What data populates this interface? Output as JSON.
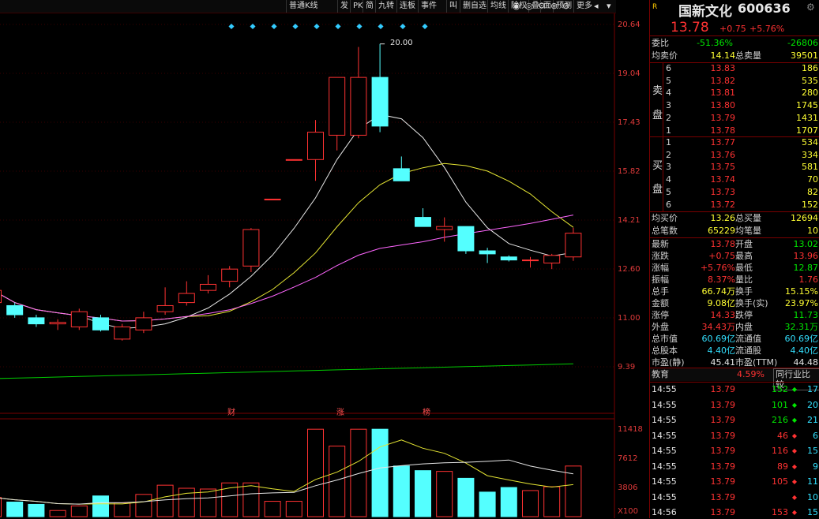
{
  "toolbar": {
    "items": [
      "普通K线",
      "发",
      "PK",
      "简",
      "九转",
      "连板",
      "事件",
      "叫",
      "删自选",
      "均线",
      "除权",
      "叠",
      "面",
      "预测",
      "更多"
    ],
    "icons": [
      "eye-icon",
      "eye-off-icon",
      "settings-icon",
      "zoom-in-icon",
      "zoom-out-icon",
      "back-icon",
      "next-icon"
    ]
  },
  "chart": {
    "y_ticks": [
      "20.64",
      "19.04",
      "17.43",
      "15.82",
      "14.21",
      "12.60",
      "11.00",
      "9.39"
    ],
    "high_label": "20.00",
    "event_markers": [
      "财",
      "涨",
      "榜"
    ],
    "volume_ticks": [
      "11418",
      "7612",
      "3806",
      "X100"
    ]
  },
  "chart_data": [
    {
      "type": "candlestick",
      "title": "",
      "ylim": [
        9.39,
        20.64
      ],
      "candles": [
        {
          "o": 11.5,
          "c": 11.9,
          "h": 12.0,
          "l": 11.4,
          "up": true
        },
        {
          "o": 11.4,
          "c": 11.1,
          "h": 11.5,
          "l": 11.0,
          "up": false
        },
        {
          "o": 11.0,
          "c": 10.8,
          "h": 11.1,
          "l": 10.7,
          "up": false
        },
        {
          "o": 10.8,
          "c": 10.85,
          "h": 10.95,
          "l": 10.6,
          "up": true
        },
        {
          "o": 11.2,
          "c": 10.7,
          "h": 11.3,
          "l": 10.6,
          "up": true
        },
        {
          "o": 11.0,
          "c": 10.6,
          "h": 11.1,
          "l": 10.55,
          "up": false
        },
        {
          "o": 10.7,
          "c": 10.3,
          "h": 10.8,
          "l": 10.25,
          "up": true
        },
        {
          "o": 10.6,
          "c": 11.0,
          "h": 11.2,
          "l": 10.5,
          "up": true
        },
        {
          "o": 11.2,
          "c": 11.4,
          "h": 12.0,
          "l": 11.1,
          "up": true
        },
        {
          "o": 11.5,
          "c": 11.8,
          "h": 12.2,
          "l": 11.4,
          "up": true
        },
        {
          "o": 11.9,
          "c": 12.1,
          "h": 12.4,
          "l": 11.8,
          "up": true
        },
        {
          "o": 12.2,
          "c": 12.6,
          "h": 12.7,
          "l": 12.0,
          "up": true
        },
        {
          "o": 12.7,
          "c": 13.9,
          "h": 13.95,
          "l": 12.5,
          "up": true
        },
        {
          "o": 14.9,
          "c": 14.9,
          "h": 14.9,
          "l": 14.9,
          "up": true
        },
        {
          "o": 16.2,
          "c": 16.2,
          "h": 16.2,
          "l": 16.2,
          "up": true
        },
        {
          "o": 16.2,
          "c": 17.1,
          "h": 17.5,
          "l": 15.5,
          "up": true
        },
        {
          "o": 17.0,
          "c": 18.9,
          "h": 18.9,
          "l": 16.5,
          "up": true
        },
        {
          "o": 17.0,
          "c": 18.9,
          "h": 19.9,
          "l": 16.9,
          "up": true
        },
        {
          "o": 18.9,
          "c": 17.3,
          "h": 20.0,
          "l": 17.1,
          "up": false
        },
        {
          "o": 15.9,
          "c": 15.5,
          "h": 16.3,
          "l": 15.5,
          "up": false
        },
        {
          "o": 14.3,
          "c": 14.0,
          "h": 14.6,
          "l": 14.0,
          "up": false
        },
        {
          "o": 13.9,
          "c": 14.0,
          "h": 14.3,
          "l": 13.5,
          "up": true
        },
        {
          "o": 14.0,
          "c": 13.2,
          "h": 14.0,
          "l": 13.1,
          "up": false
        },
        {
          "o": 13.2,
          "c": 13.1,
          "h": 13.3,
          "l": 12.8,
          "up": false
        },
        {
          "o": 13.0,
          "c": 12.9,
          "h": 13.05,
          "l": 12.85,
          "up": false
        },
        {
          "o": 12.9,
          "c": 12.9,
          "h": 13.0,
          "l": 12.65,
          "up": true
        },
        {
          "o": 12.8,
          "c": 13.05,
          "h": 13.1,
          "l": 12.6,
          "up": true
        },
        {
          "o": 13.0,
          "c": 13.78,
          "h": 13.96,
          "l": 12.87,
          "up": true
        }
      ],
      "volumes": [
        2500,
        1900,
        1600,
        800,
        1400,
        2700,
        1800,
        2900,
        4100,
        3700,
        3600,
        4400,
        4400,
        2000,
        2000,
        11400,
        9200,
        11400,
        11400,
        6600,
        6000,
        5900,
        5000,
        3200,
        3800,
        3400,
        3900,
        6600
      ]
    }
  ],
  "quote": {
    "name": "国新文化",
    "code": "600636",
    "price": "13.78",
    "change": "+0.75",
    "change_pct": "+5.76%",
    "weibi_label": "委比",
    "weibi": "-51.36%",
    "weicha": "-26806",
    "avg_sell_label": "均卖价",
    "avg_sell": "14.14",
    "total_sell_label": "总卖量",
    "total_sell": "39501",
    "sell_side_label": [
      "卖",
      "盘"
    ],
    "buy_side_label": [
      "买",
      "盘"
    ],
    "asks": [
      {
        "lvl": "6",
        "p": "13.83",
        "v": "186"
      },
      {
        "lvl": "5",
        "p": "13.82",
        "v": "535"
      },
      {
        "lvl": "4",
        "p": "13.81",
        "v": "280"
      },
      {
        "lvl": "3",
        "p": "13.80",
        "v": "1745"
      },
      {
        "lvl": "2",
        "p": "13.79",
        "v": "1431"
      },
      {
        "lvl": "1",
        "p": "13.78",
        "v": "1707"
      }
    ],
    "bids": [
      {
        "lvl": "1",
        "p": "13.77",
        "v": "534"
      },
      {
        "lvl": "2",
        "p": "13.76",
        "v": "334"
      },
      {
        "lvl": "3",
        "p": "13.75",
        "v": "581"
      },
      {
        "lvl": "4",
        "p": "13.74",
        "v": "70"
      },
      {
        "lvl": "5",
        "p": "13.73",
        "v": "82"
      },
      {
        "lvl": "6",
        "p": "13.72",
        "v": "152"
      }
    ],
    "avg_buy_label": "均买价",
    "avg_buy": "13.26",
    "total_buy_label": "总买量",
    "total_buy": "12694",
    "total_orders_label": "总笔数",
    "total_orders": "65229",
    "avg_order_label": "均笔量",
    "avg_order": "10",
    "stats": [
      {
        "l1": "最新",
        "v1": "13.78",
        "c1": "red",
        "l2": "开盘",
        "v2": "13.02",
        "c2": "green"
      },
      {
        "l1": "涨跌",
        "v1": "+0.75",
        "c1": "red",
        "l2": "最高",
        "v2": "13.96",
        "c2": "red"
      },
      {
        "l1": "涨幅",
        "v1": "+5.76%",
        "c1": "red",
        "l2": "最低",
        "v2": "12.87",
        "c2": "green"
      },
      {
        "l1": "振幅",
        "v1": "8.37%",
        "c1": "red",
        "l2": "量比",
        "v2": "1.76",
        "c2": "red"
      },
      {
        "l1": "总手",
        "v1": "66.74万",
        "c1": "yellow",
        "l2": "换手",
        "v2": "15.15%",
        "c2": "yellow"
      },
      {
        "l1": "金额",
        "v1": "9.08亿",
        "c1": "yellow",
        "l2": "换手(实)",
        "v2": "23.97%",
        "c2": "yellow"
      },
      {
        "l1": "涨停",
        "v1": "14.33",
        "c1": "red",
        "l2": "跌停",
        "v2": "11.73",
        "c2": "green"
      },
      {
        "l1": "外盘",
        "v1": "34.43万",
        "c1": "red",
        "l2": "内盘",
        "v2": "32.31万",
        "c2": "green"
      },
      {
        "l1": "总市值",
        "v1": "60.69亿",
        "c1": "cyan",
        "l2": "流通值",
        "v2": "60.69亿",
        "c2": "cyan"
      },
      {
        "l1": "总股本",
        "v1": "4.40亿",
        "c1": "cyan",
        "l2": "流通股",
        "v2": "4.40亿",
        "c2": "cyan"
      },
      {
        "l1": "市盈(静)",
        "v1": "45.41",
        "c1": "white",
        "l2": "市盈(TTM)",
        "v2": "44.48",
        "c2": "white"
      }
    ],
    "industry_label": "教育",
    "industry_pct": "4.59%",
    "peer_label": "同行业比较",
    "ticks": [
      {
        "t": "14:55",
        "p": "13.79",
        "v": "152",
        "dir": "down",
        "n": "17"
      },
      {
        "t": "14:55",
        "p": "13.79",
        "v": "101",
        "dir": "down",
        "n": "20"
      },
      {
        "t": "14:55",
        "p": "13.79",
        "v": "216",
        "dir": "down",
        "n": "21"
      },
      {
        "t": "14:55",
        "p": "13.79",
        "v": "46",
        "dir": "up",
        "n": "6"
      },
      {
        "t": "14:55",
        "p": "13.79",
        "v": "116",
        "dir": "up",
        "n": "15"
      },
      {
        "t": "14:55",
        "p": "13.79",
        "v": "89",
        "dir": "up",
        "n": "9"
      },
      {
        "t": "14:55",
        "p": "13.79",
        "v": "105",
        "dir": "up",
        "n": "11"
      },
      {
        "t": "14:55",
        "p": "13.79",
        "v": "",
        "dir": "up",
        "n": "10"
      },
      {
        "t": "14:56",
        "p": "13.79",
        "v": "153",
        "dir": "up",
        "n": "15"
      }
    ]
  }
}
